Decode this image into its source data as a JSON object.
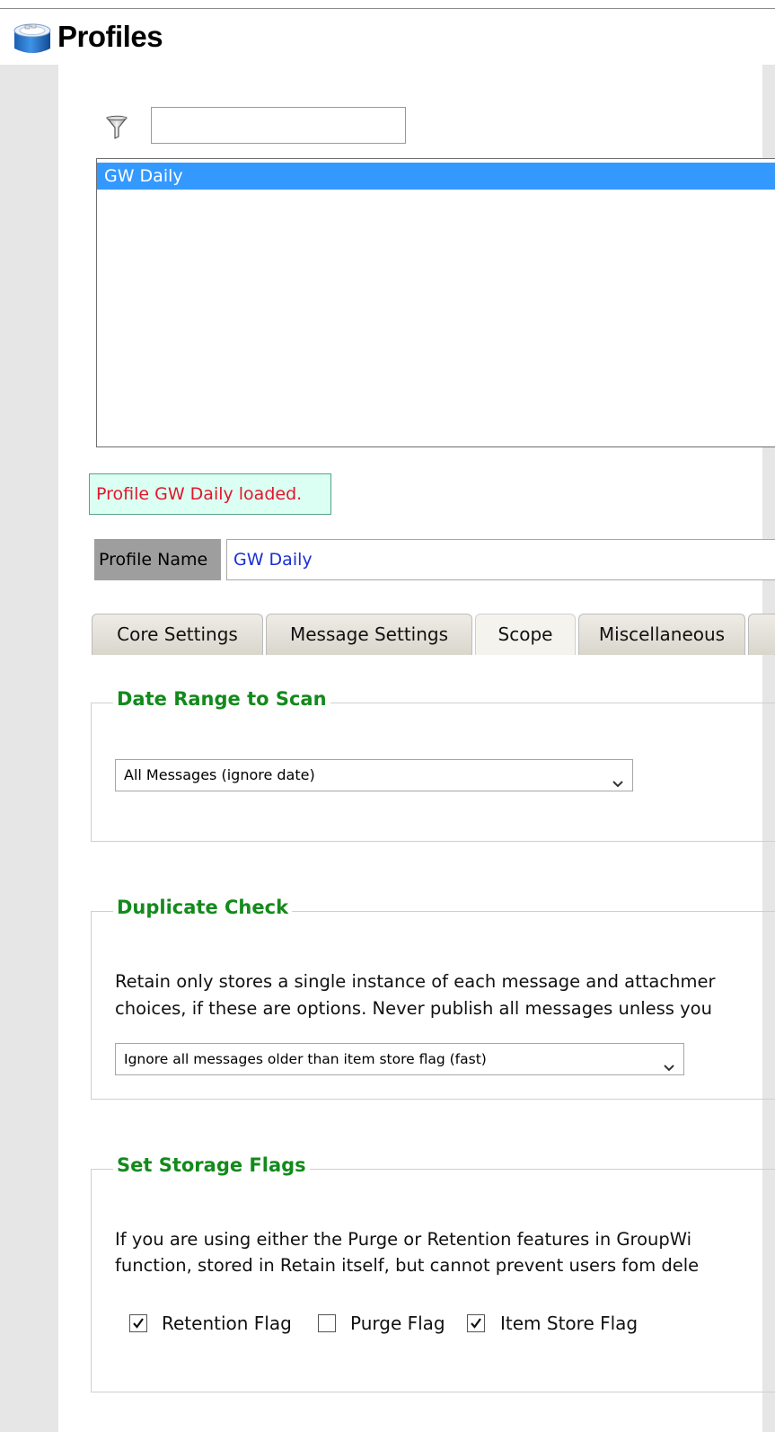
{
  "header": {
    "title": "Profiles",
    "icon": "database-icon"
  },
  "filter": {
    "icon": "funnel-icon",
    "value": ""
  },
  "profile_list": {
    "items": [
      {
        "label": "GW Daily",
        "selected": true
      }
    ]
  },
  "status": {
    "message": "Profile GW Daily loaded."
  },
  "profile_name": {
    "label": "Profile Name",
    "value": "GW Daily"
  },
  "tabs": [
    {
      "label": "Core Settings",
      "active": false
    },
    {
      "label": "Message Settings",
      "active": false
    },
    {
      "label": "Scope",
      "active": true
    },
    {
      "label": "Miscellaneous",
      "active": false
    }
  ],
  "date_range": {
    "legend": "Date Range to Scan",
    "selected": "All Messages (ignore date)"
  },
  "duplicate_check": {
    "legend": "Duplicate Check",
    "line1": "Retain only stores a single instance of each message and attachmer",
    "line2": "choices, if these are options. Never publish all messages unless you",
    "selected": "Ignore all messages older than item store flag (fast)"
  },
  "storage_flags": {
    "legend": "Set Storage Flags",
    "line1": "If you are using either the Purge or Retention features in GroupWi",
    "line2": "function, stored in Retain itself, but cannot prevent users fom dele",
    "retention": {
      "label": "Retention Flag",
      "checked": true
    },
    "purge": {
      "label": "Purge Flag",
      "checked": false
    },
    "item_store": {
      "label": "Item Store Flag",
      "checked": true
    }
  },
  "colors": {
    "legend_green": "#138a1c",
    "selection_blue": "#3399ff",
    "status_red": "#e3162a",
    "status_bg": "#dcfff3",
    "name_value_blue": "#1a2fd6"
  }
}
